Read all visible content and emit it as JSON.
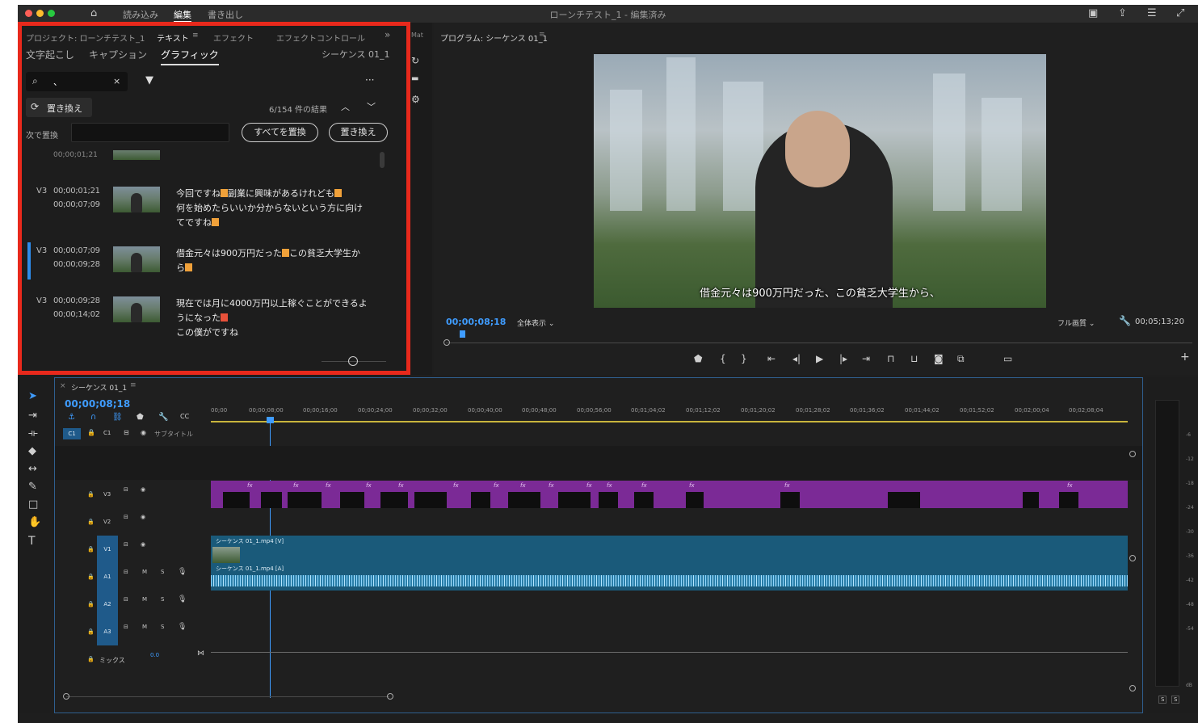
{
  "titlebar": {
    "menu": [
      "読み込み",
      "編集",
      "書き出し"
    ],
    "active_menu": "編集",
    "doc_title": "ローンチテスト_1 - 編集済み"
  },
  "left_panel": {
    "tabs": [
      "プロジェクト: ローンチテスト_1",
      "テキスト",
      "エフェクト",
      "エフェクトコントロール"
    ],
    "active_tab": "テキスト",
    "subtabs": [
      "文字起こし",
      "キャプション",
      "グラフィック"
    ],
    "active_subtab": "グラフィック",
    "sequence_name": "シーケンス 01_1",
    "search_value": "、",
    "replace_button": "置き換え",
    "results_count": "6/154 件の結果",
    "replace_with_label": "次で置換",
    "replace_all_button": "すべてを置換",
    "replace_one_button": "置き換え",
    "partial_time": "00;00;01;21",
    "results": [
      {
        "track": "V3",
        "in": "00;00;01;21",
        "out": "00;00;07;09",
        "line1": "今回ですね",
        "line1b": "副業に興味があるけれども",
        "line2": "何を始めたらいいか分からないという方に向け",
        "line3": "てですね"
      },
      {
        "track": "V3",
        "in": "00;00;07;09",
        "out": "00;00;09;28",
        "line1": "借金元々は900万円だった",
        "line1b": "この貧乏大学生か",
        "line2": "ら",
        "line3": ""
      },
      {
        "track": "V3",
        "in": "00;00;09;28",
        "out": "00;00;14;02",
        "line1": "現在では月に4000万円以上稼ぐことができるよ",
        "line1b": "",
        "line2": "うになった",
        "line3": "この僕がですね"
      }
    ]
  },
  "program": {
    "title": "プログラム: シーケンス 01_1",
    "caption": "借金元々は900万円だった、この貧乏大学生から、",
    "timecode": "00;00;08;18",
    "fit": "全体表示",
    "quality": "フル画質",
    "duration": "00;05;13;20"
  },
  "timeline": {
    "title": "シーケンス 01_1",
    "timecode": "00;00;08;18",
    "subtitle_track": "サブタイトル",
    "ruler": [
      "00;00",
      "00;00;08;00",
      "00;00;16;00",
      "00;00;24;00",
      "00;00;32;00",
      "00;00;40;00",
      "00;00;48;00",
      "00;00;56;00",
      "00;01;04;02",
      "00;01;12;02",
      "00;01;20;02",
      "00;01;28;02",
      "00;01;36;02",
      "00;01;44;02",
      "00;01;52;02",
      "00;02;00;04",
      "00;02;08;04"
    ],
    "tracks": [
      "V3",
      "V2",
      "V1",
      "A1",
      "A2",
      "A3"
    ],
    "clip_video": "シーケンス 01_1.mp4 [V]",
    "clip_audio": "シーケンス 01_1.mp4 [A]",
    "mix_label": "ミックス",
    "mix_value": "0.0",
    "track_m": "M",
    "track_s": "S",
    "c1_label": "C1",
    "meter_labels": [
      "-6",
      "-12",
      "-18",
      "-24",
      "-30",
      "-36",
      "-42",
      "-48",
      "-54",
      "dB"
    ],
    "meter_solo": "S"
  },
  "colors": {
    "highlight_red": "#e8291c",
    "accent_blue": "#2d8ceb",
    "graphic_clip": "#7b2a96",
    "video_clip": "#1a5a7a"
  }
}
